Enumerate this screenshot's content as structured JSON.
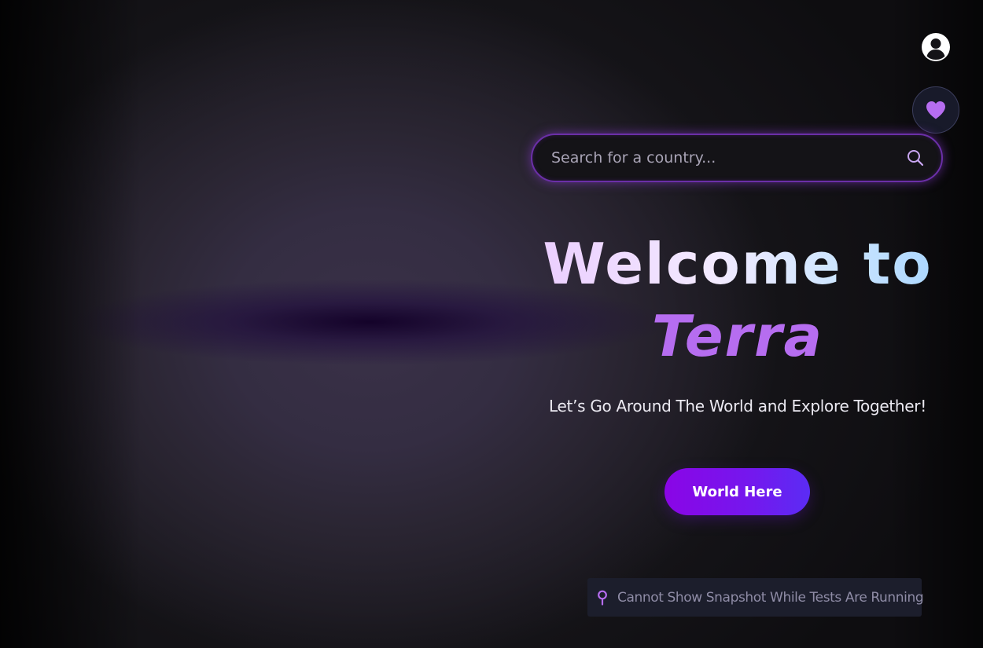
{
  "header": {
    "profile_icon": "user-circle-icon",
    "favorites_icon": "heart-icon"
  },
  "search": {
    "placeholder": "Search for a country...",
    "value": "",
    "icon": "search-icon"
  },
  "hero": {
    "title_line1": "Welcome to",
    "title_line2": "Terra",
    "subtitle": "Let’s Go Around The World and Explore Together!"
  },
  "cta": {
    "label": "World Here"
  },
  "notice": {
    "icon": "map-pin-icon",
    "text": "Cannot Show Snapshot While Tests Are Running"
  },
  "colors": {
    "accent_purple": "#b66df0",
    "button_gradient_start": "#8a05e6",
    "button_gradient_end": "#5b2cf4",
    "search_border": "#6b2fa8",
    "heart": "#b66df0"
  }
}
